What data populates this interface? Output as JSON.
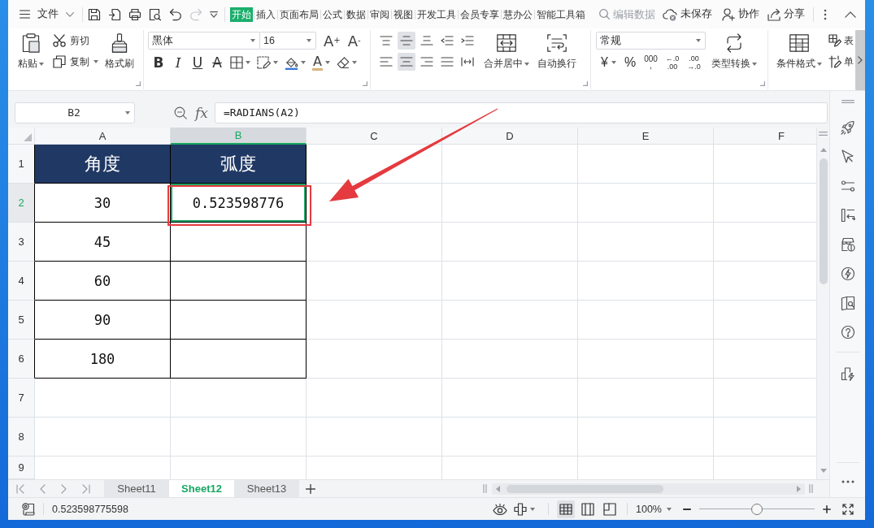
{
  "menu_bar": {
    "file_menu": "文件",
    "quick_access": [
      {
        "kind": "save",
        "disabled": false
      },
      {
        "kind": "export",
        "disabled": false
      },
      {
        "kind": "print",
        "disabled": false
      },
      {
        "kind": "preview",
        "disabled": false
      },
      {
        "kind": "undo",
        "disabled": false
      },
      {
        "kind": "redo",
        "disabled": true
      }
    ],
    "tabs": [
      {
        "label": "开始",
        "selected": true
      },
      {
        "label": "插入",
        "selected": false
      },
      {
        "label": "页面布局",
        "selected": false
      },
      {
        "label": "公式",
        "selected": false
      },
      {
        "label": "数据",
        "selected": false
      },
      {
        "label": "审阅",
        "selected": false
      },
      {
        "label": "视图",
        "selected": false
      },
      {
        "label": "开发工具",
        "selected": false
      },
      {
        "label": "会员专享",
        "selected": false
      },
      {
        "label": "慧办公",
        "selected": false
      },
      {
        "label": "智能工具箱",
        "selected": false
      }
    ],
    "search": {
      "placeholder": "编辑数据"
    },
    "save_status": "未保存",
    "collaborate": "协作",
    "share": "分享"
  },
  "ribbon": {
    "clipboard": {
      "paste": "粘贴",
      "cut": "剪切",
      "copy": "复制",
      "format_painter": "格式刷"
    },
    "font": {
      "font_name": "黑体",
      "font_size": "16",
      "grow": "A$^{+}$",
      "shrink": "A$^{-}$",
      "styles": [
        {
          "kind": "bold",
          "label": "B"
        },
        {
          "kind": "italic",
          "label": "I"
        },
        {
          "kind": "underline",
          "label": "U"
        },
        {
          "kind": "strikethrough",
          "label": "A"
        }
      ],
      "font_color": "A"
    },
    "alignment": {
      "vertical": [
        {
          "kind": "top",
          "selected": false
        },
        {
          "kind": "middle",
          "selected": true
        },
        {
          "kind": "bottom",
          "selected": false
        }
      ],
      "horizontal": [
        {
          "kind": "left",
          "selected": false
        },
        {
          "kind": "center",
          "selected": true
        },
        {
          "kind": "right",
          "selected": false
        }
      ],
      "merge": "合并居中",
      "wrap": "自动换行"
    },
    "number": {
      "format": "常规",
      "buttons": [
        {
          "kind": "currency",
          "lines": [
            "¥"
          ]
        },
        {
          "kind": "percent",
          "lines": [
            "%"
          ]
        },
        {
          "kind": "thousands",
          "lines": [
            "000",
            ","
          ]
        },
        {
          "kind": "add_decimal",
          "lines": [
            "←.0",
            ".00"
          ]
        },
        {
          "kind": "remove_decimal",
          "lines": [
            ".00",
            "→.0"
          ]
        }
      ],
      "convert": "类型转换"
    },
    "styles": {
      "conditional": "条件格式",
      "table_style": "表",
      "cell_style": "单"
    }
  },
  "formula_bar": {
    "name_box": "B2",
    "function_label": "fx",
    "formula": "=RADIANS(A2)"
  },
  "sheet": {
    "columns": [
      {
        "label": "A",
        "selected": false
      },
      {
        "label": "B",
        "selected": true
      },
      {
        "label": "C",
        "selected": false
      },
      {
        "label": "D",
        "selected": false
      },
      {
        "label": "E",
        "selected": false
      },
      {
        "label": "F",
        "selected": false
      }
    ],
    "rows": [
      {
        "label": "1",
        "selected": false
      },
      {
        "label": "2",
        "selected": true
      },
      {
        "label": "3",
        "selected": false
      },
      {
        "label": "4",
        "selected": false
      },
      {
        "label": "5",
        "selected": false
      },
      {
        "label": "6",
        "selected": false
      },
      {
        "label": "7",
        "selected": false
      },
      {
        "label": "8",
        "selected": false
      },
      {
        "label": "9",
        "selected": false
      }
    ],
    "table": {
      "header": [
        {
          "text": "角度",
          "selected": false
        },
        {
          "text": "弧度",
          "selected": false
        }
      ],
      "rows": [
        {
          "cells": [
            {
              "text": "30",
              "selected": false
            },
            {
              "text": "0.523598776",
              "selected": true
            }
          ]
        },
        {
          "cells": [
            {
              "text": "45",
              "selected": false
            }
          ]
        },
        {
          "cells": [
            {
              "text": "60",
              "selected": false
            }
          ]
        },
        {
          "cells": [
            {
              "text": "90",
              "selected": false
            }
          ]
        },
        {
          "cells": [
            {
              "text": "180",
              "selected": false
            }
          ]
        }
      ]
    }
  },
  "sheet_tabs": [
    {
      "label": "Sheet11",
      "selected": false
    },
    {
      "label": "Sheet12",
      "selected": true
    },
    {
      "label": "Sheet13",
      "selected": false
    }
  ],
  "status_bar": {
    "value": "0.523598775598",
    "view_modes": [
      {
        "kind": "normal",
        "selected": true
      },
      {
        "kind": "page_break",
        "selected": false
      },
      {
        "kind": "page_layout",
        "selected": false
      }
    ],
    "zoom": "100%",
    "zoom_slider": {
      "level": 0.5
    }
  }
}
